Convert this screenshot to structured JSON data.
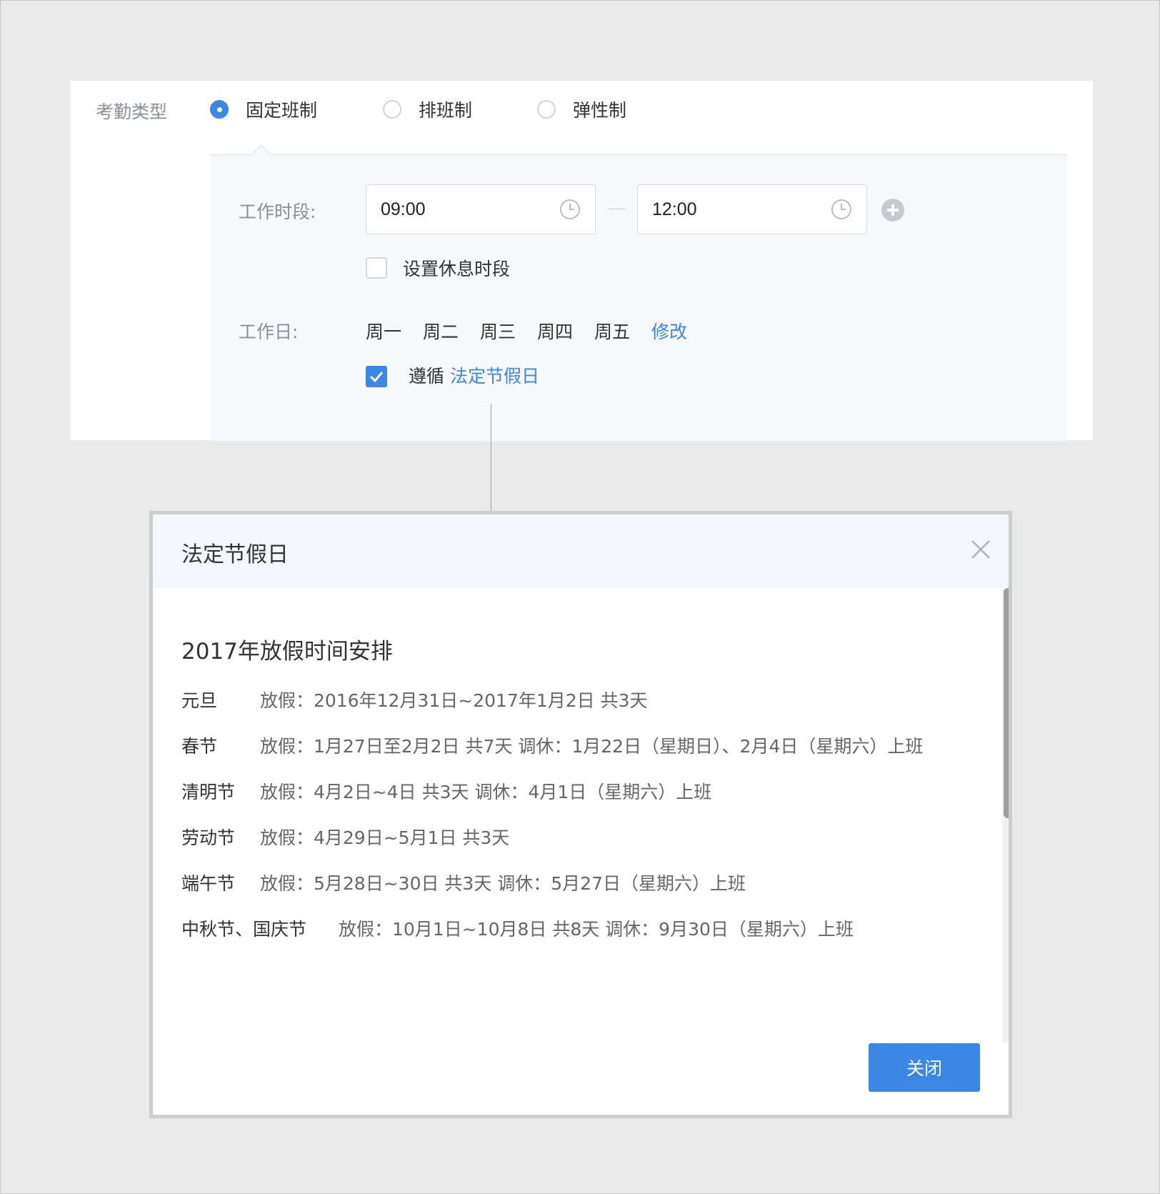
{
  "attendance": {
    "type_label": "考勤类型",
    "options": [
      {
        "label": "固定班制",
        "checked": true
      },
      {
        "label": "排班制",
        "checked": false
      },
      {
        "label": "弹性制",
        "checked": false
      }
    ],
    "work_hours_label": "工作时段:",
    "start_time": "09:00",
    "end_time": "12:00",
    "break_label": "设置休息时段",
    "break_checked": false,
    "workdays_label": "工作日:",
    "workdays": [
      "周一",
      "周二",
      "周三",
      "周四",
      "周五"
    ],
    "modify_link": "修改",
    "follow_label": "遵循",
    "follow_link": "法定节假日",
    "follow_checked": true
  },
  "modal": {
    "title": "法定节假日",
    "schedule_title": "2017年放假时间安排",
    "holidays": [
      {
        "name": "元旦",
        "detail": "放假：2016年12月31日~2017年1月2日 共3天"
      },
      {
        "name": "春节",
        "detail": "放假：1月27日至2月2日 共7天 调休：1月22日（星期日）、2月4日（星期六）上班"
      },
      {
        "name": "清明节",
        "detail": "放假：4月2日~4日 共3天 调休：4月1日（星期六）上班"
      },
      {
        "name": "劳动节",
        "detail": "放假：4月29日~5月1日 共3天"
      },
      {
        "name": "端午节",
        "detail": "放假：5月28日~30日 共3天 调休：5月27日（星期六）上班"
      },
      {
        "name": "中秋节、国庆节",
        "detail": "放假：10月1日~10月8日 共8天 调休：9月30日（星期六）上班"
      }
    ],
    "close_button": "关闭"
  },
  "colors": {
    "accent": "#3a87e4",
    "background": "#e9e9e9",
    "panel": "#f6f8fb"
  },
  "icons": {
    "time": "clock-icon",
    "add": "plus-circle-icon",
    "close": "close-icon",
    "check": "check-icon"
  }
}
